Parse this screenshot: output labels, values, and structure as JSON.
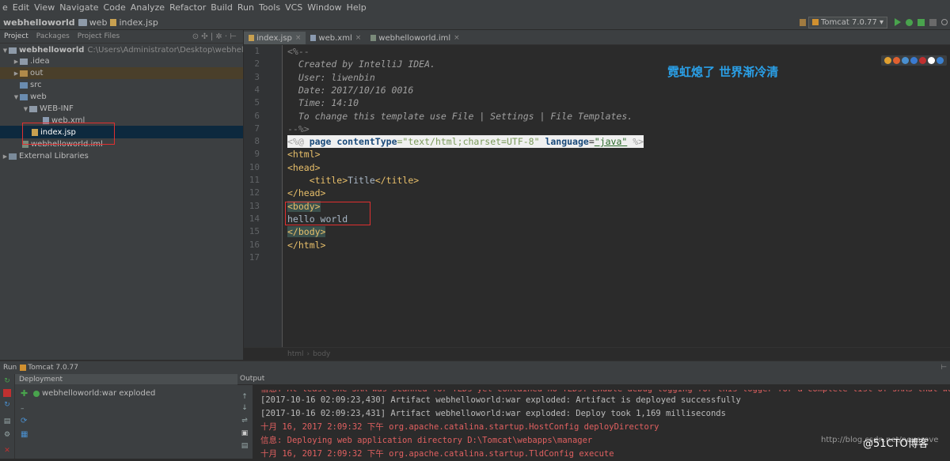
{
  "menu": [
    "e",
    "Edit",
    "View",
    "Navigate",
    "Code",
    "Analyze",
    "Refactor",
    "Build",
    "Run",
    "Tools",
    "VCS",
    "Window",
    "Help"
  ],
  "nav": {
    "crumbs": [
      "webhelloworld",
      "web",
      "index.jsp"
    ],
    "run_config": "Tomcat 7.0.77 ▾"
  },
  "project_panel": {
    "tabs": [
      "Project",
      "Packages",
      "Project Files"
    ],
    "tree": [
      {
        "label": "webhelloworld",
        "path": "C:\\Users\\Administrator\\Desktop\\webhelloworld"
      },
      {
        "label": ".idea"
      },
      {
        "label": "out"
      },
      {
        "label": "src"
      },
      {
        "label": "web"
      },
      {
        "label": "WEB-INF"
      },
      {
        "label": "web.xml"
      },
      {
        "label": "index.jsp"
      },
      {
        "label": "webhelloworld.iml"
      },
      {
        "label": "External Libraries"
      }
    ]
  },
  "editor": {
    "tabs": [
      "index.jsp",
      "web.xml",
      "webhelloworld.iml"
    ],
    "line_numbers": [
      "1",
      "2",
      "3",
      "4",
      "5",
      "6",
      "7",
      "8",
      "9",
      "10",
      "11",
      "12",
      "13",
      "14",
      "15",
      "16",
      "17"
    ],
    "lines": {
      "l1": "<%--",
      "l2": "  Created by IntelliJ IDEA.",
      "l3": "  User: liwenbin",
      "l4": "  Date: 2017/10/16 0016",
      "l5": "  Time: 14:10",
      "l6": "  To change this template use File | Settings | File Templates.",
      "l7": "--%>",
      "l8a": "<%@ ",
      "l8b": "page",
      "l8c": " contentType",
      "l8d": "=\"text/html;charset=UTF-8\"",
      "l8e": " language",
      "l8f": "=",
      "l8g": "\"java\"",
      "l8h": " %>",
      "l9": "<html>",
      "l10": "<head>",
      "l11a": "    <title>",
      "l11b": "Title",
      "l11c": "</title>",
      "l12": "</head>",
      "l13": "<body>",
      "l14": "hello world",
      "l15": "</body>",
      "l16": "</html>"
    },
    "overlay_text": "霓虹熄了 世界渐冷清",
    "breadcrumb": [
      "html",
      "body"
    ]
  },
  "run_panel": {
    "title": "Run",
    "config": "Tomcat 7.0.77",
    "deployment_header": "Deployment",
    "output_header": "Output",
    "deployment_item": "webhelloworld:war exploded",
    "log": [
      {
        "text": "信息: At least one JAR was scanned for TLDs yet contained no TLDs. Enable debug logging for this logger for a complete list of JARs that were scanne",
        "kind": "red"
      },
      {
        "text": "[2017-10-16 02:09:23,430] Artifact webhelloworld:war exploded: Artifact is deployed successfully",
        "kind": "info"
      },
      {
        "text": "[2017-10-16 02:09:23,431] Artifact webhelloworld:war exploded: Deploy took 1,169 milliseconds",
        "kind": "info"
      },
      {
        "text": "十月 16, 2017 2:09:32 下午 org.apache.catalina.startup.HostConfig deployDirectory",
        "kind": "red"
      },
      {
        "text": "信息: Deploying web application directory D:\\Tomcat\\webapps\\manager",
        "kind": "red"
      },
      {
        "text": "十月 16, 2017 2:09:32 下午 org.apache.catalina.startup.TldConfig execute",
        "kind": "red"
      }
    ]
  },
  "watermark": {
    "url": "http://blog.csdn.net/neverove",
    "brand": "@51CTO博客"
  }
}
